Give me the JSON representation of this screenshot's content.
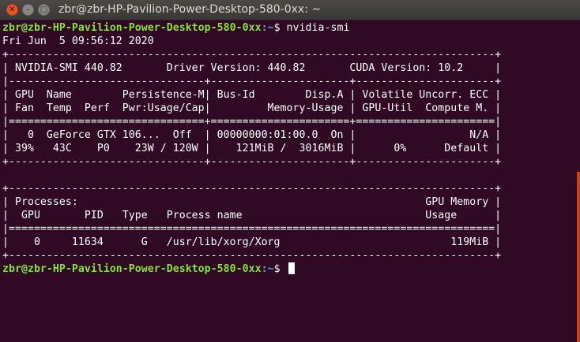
{
  "window": {
    "title": "zbr@zbr-HP-Pavilion-Power-Desktop-580-0xx: ~"
  },
  "theme": {
    "background": "#300a24",
    "prompt_user_color": "#8ae234",
    "prompt_path_color": "#729fcf",
    "close_button_color": "#e95420"
  },
  "prompt": {
    "user_host": "zbr@zbr-HP-Pavilion-Power-Desktop-580-0xx",
    "path": ":~",
    "symbol": "$ ",
    "command": "nvidia-smi"
  },
  "output": [
    "Fri Jun  5 09:56:12 2020",
    "+-----------------------------------------------------------------------------+",
    "| NVIDIA-SMI 440.82       Driver Version: 440.82       CUDA Version: 10.2     |",
    "|-------------------------------+----------------------+----------------------+",
    "| GPU  Name        Persistence-M| Bus-Id        Disp.A | Volatile Uncorr. ECC |",
    "| Fan  Temp  Perf  Pwr:Usage/Cap|         Memory-Usage | GPU-Util  Compute M. |",
    "|===============================+======================+======================|",
    "|   0  GeForce GTX 106...  Off  | 00000000:01:00.0  On |                  N/A |",
    "| 39%   43C    P0    23W / 120W |    121MiB /  3016MiB |      0%      Default |",
    "+-------------------------------+----------------------+----------------------+",
    "",
    "+-----------------------------------------------------------------------------+",
    "| Processes:                                                       GPU Memory |",
    "|  GPU       PID   Type   Process name                             Usage      |",
    "|=============================================================================|",
    "|    0     11634      G   /usr/lib/xorg/Xorg                           119MiB |",
    "+-----------------------------------------------------------------------------+"
  ]
}
